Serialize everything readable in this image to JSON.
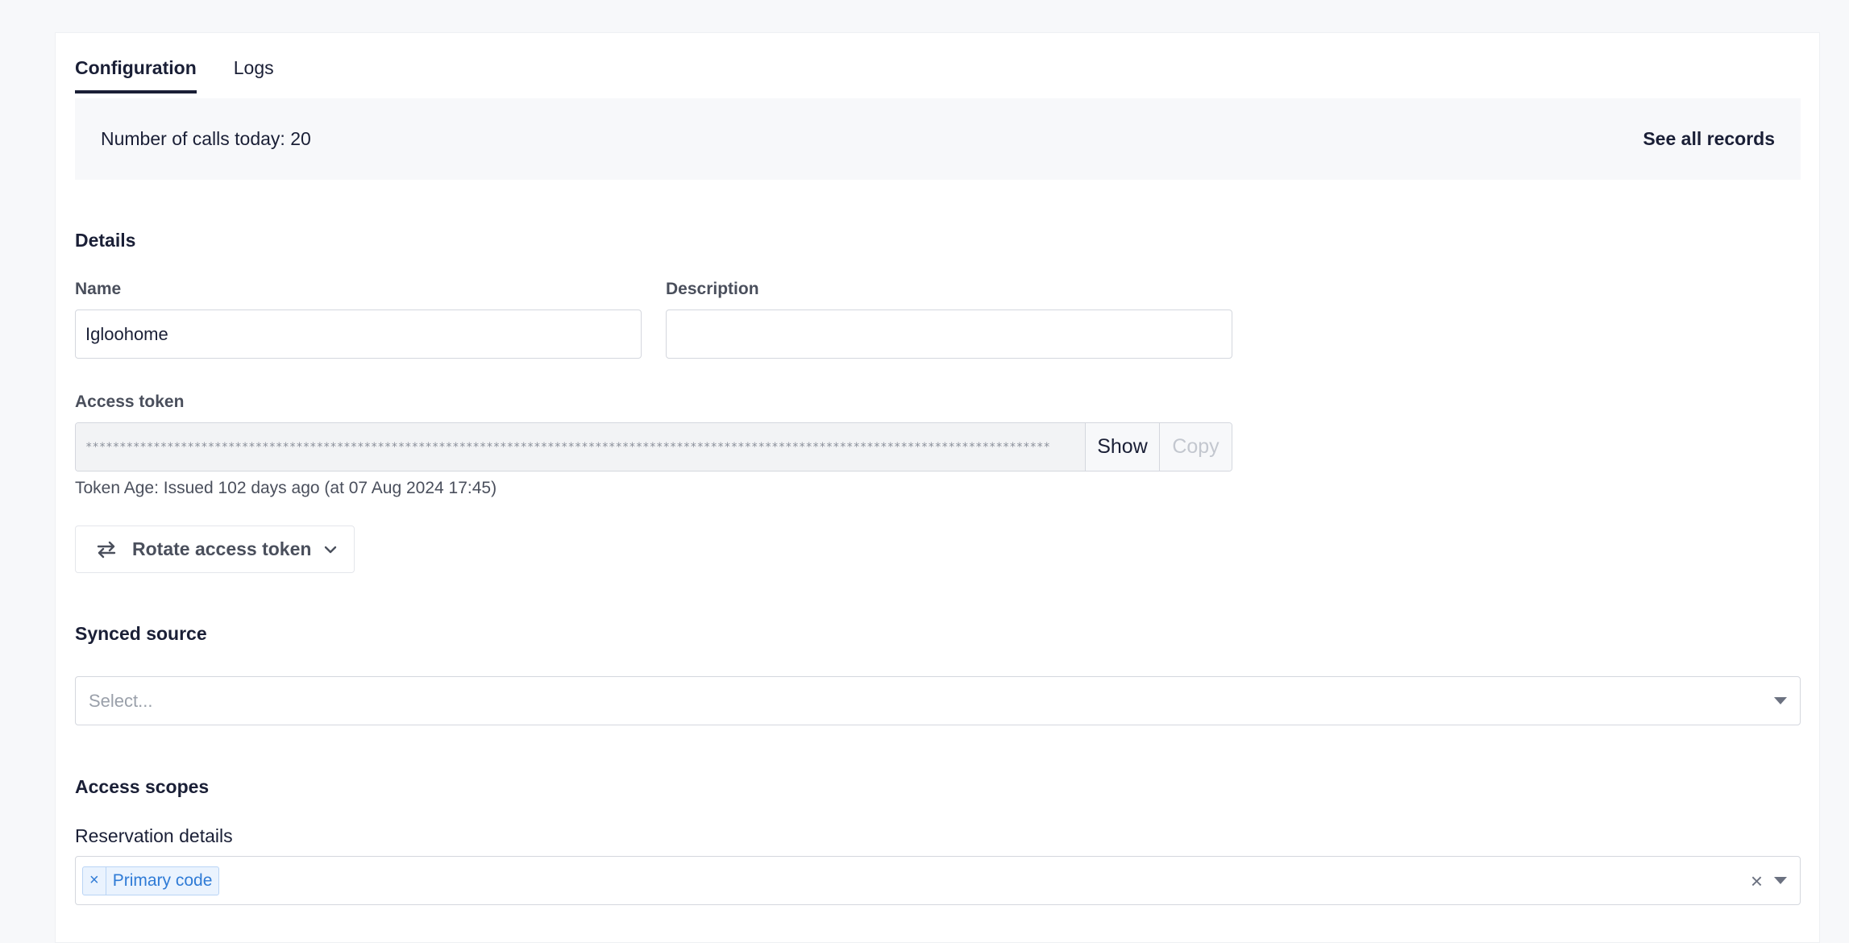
{
  "tabs": [
    {
      "label": "Configuration",
      "active": true
    },
    {
      "label": "Logs",
      "active": false
    }
  ],
  "calls": {
    "text": "Number of calls today: 20",
    "link": "See all records"
  },
  "details": {
    "title": "Details",
    "name_label": "Name",
    "name_value": "Igloohome",
    "description_label": "Description",
    "description_value": "",
    "token_label": "Access token",
    "token_masked": "**********************************************************************************************************************************************",
    "show_label": "Show",
    "copy_label": "Copy",
    "token_age": "Token Age: Issued 102 days ago (at 07 Aug 2024 17:45)",
    "rotate_label": "Rotate access token"
  },
  "synced_source": {
    "title": "Synced source",
    "placeholder": "Select..."
  },
  "access_scopes": {
    "title": "Access scopes",
    "reservation_label": "Reservation details",
    "selected": [
      "Primary code"
    ]
  },
  "icons": {
    "rotate": "arrows-rotate-icon",
    "chevron": "chevron-down-icon",
    "caret": "caret-down-icon",
    "clear": "close-icon"
  },
  "colors": {
    "tag_text": "#2f7bd6",
    "tag_bg": "#eaf3fe",
    "primary_text": "#1a1f36"
  }
}
